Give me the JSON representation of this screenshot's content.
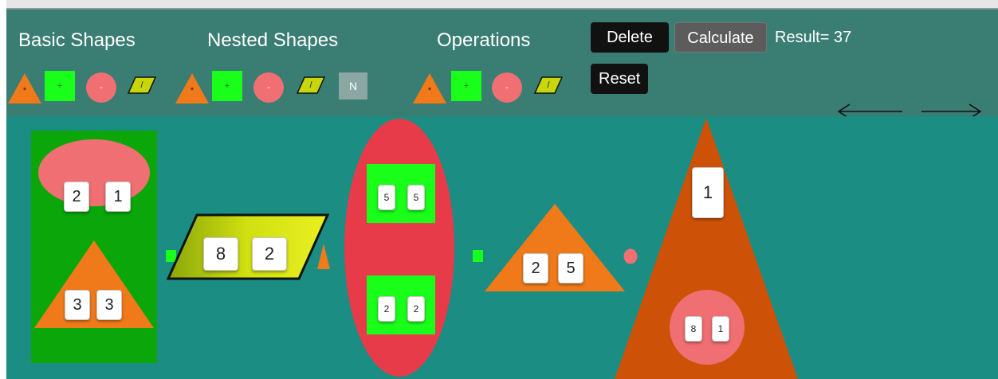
{
  "toolbar": {
    "headings": {
      "basic": "Basic Shapes",
      "nested": "Nested Shapes",
      "operations": "Operations"
    },
    "tool_symbols": {
      "triangle": "*",
      "square": "+",
      "circle": "-",
      "parallelogram": "/"
    },
    "nested_label": "N",
    "delete_label": "Delete",
    "calculate_label": "Calculate",
    "reset_label": "Reset",
    "result_text": "Result= 37"
  },
  "canvas": {
    "green_rect": {
      "ellipse_values": [
        "2",
        "1"
      ],
      "triangle_values": [
        "3",
        "3"
      ]
    },
    "parallelogram": {
      "values": [
        "8",
        "2"
      ]
    },
    "red_ellipse": {
      "top_square_values": [
        "5",
        "5"
      ],
      "bottom_square_values": [
        "2",
        "2"
      ]
    },
    "small_triangle": {
      "values": [
        "2",
        "5"
      ]
    },
    "big_triangle": {
      "top_value": "1",
      "circle_values": [
        "8",
        "1"
      ]
    }
  },
  "colors": {
    "toolbar_bg": "#3a7d73",
    "canvas_bg": "#1b8d82",
    "triangle": "#f07a1a",
    "square": "#19ff19",
    "circle": "#f06f73",
    "parallelogram": "#c8d60c",
    "green_rect": "#0aa60a",
    "red_ellipse": "#e83b4a",
    "big_triangle": "#cd5207"
  }
}
